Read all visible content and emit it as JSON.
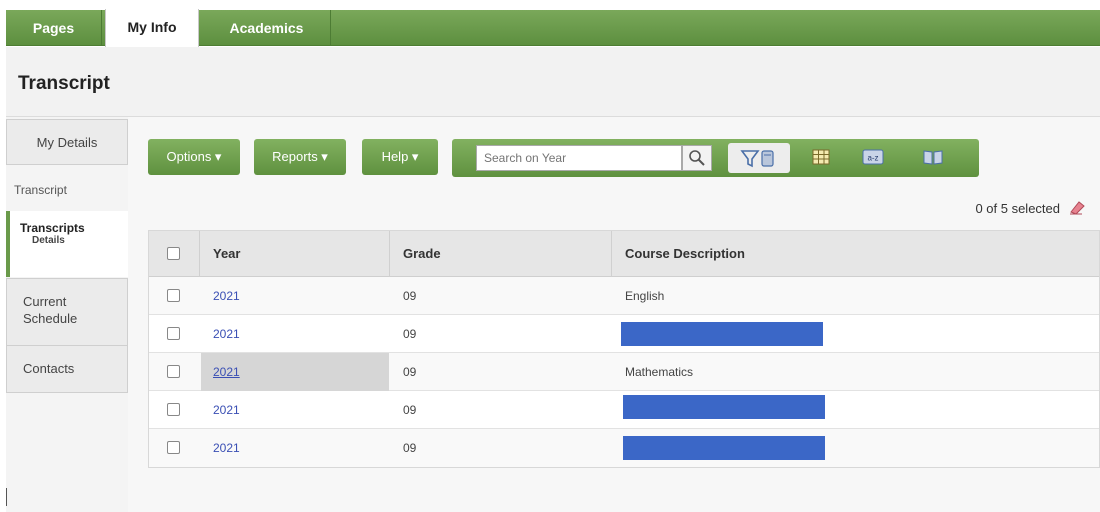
{
  "tabs": [
    {
      "label": "Pages"
    },
    {
      "label": "My Info"
    },
    {
      "label": "Academics"
    }
  ],
  "page_title": "Transcript",
  "sidenav": {
    "my_details": "My Details",
    "section_label": "Transcript",
    "transcripts": "Transcripts",
    "transcripts_sub": "Details",
    "current_schedule_l1": "Current",
    "current_schedule_l2": "Schedule",
    "contacts": "Contacts"
  },
  "toolbar": {
    "options": "Options ▾",
    "reports": "Reports ▾",
    "help": "Help ▾",
    "search_placeholder": "Search on Year"
  },
  "selection_status": "0 of 5 selected",
  "table": {
    "columns": [
      "Year",
      "Grade",
      "Course Description"
    ],
    "rows": [
      {
        "year": "2021",
        "grade": "09",
        "course": "English"
      },
      {
        "year": "2021",
        "grade": "09",
        "course": ""
      },
      {
        "year": "2021",
        "grade": "09",
        "course": "Mathematics"
      },
      {
        "year": "2021",
        "grade": "09",
        "course": ""
      },
      {
        "year": "2021",
        "grade": "09",
        "course": ""
      }
    ]
  },
  "colors": {
    "accent_green": "#6a9a4a",
    "link_blue": "#3a4fb4",
    "redaction_blue": "#3b67c7"
  }
}
